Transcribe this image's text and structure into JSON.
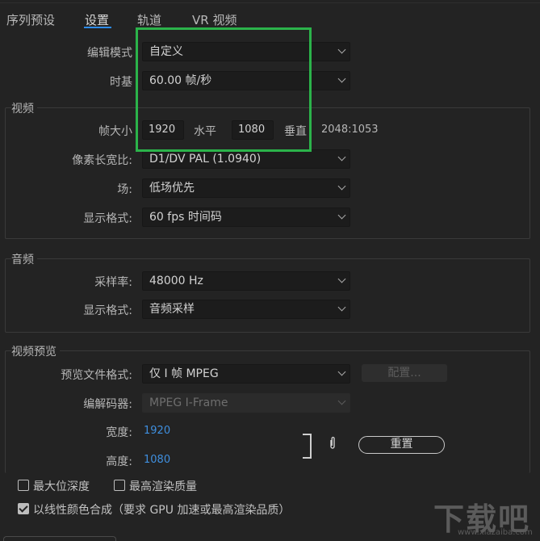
{
  "tabs": [
    {
      "label": "序列预设"
    },
    {
      "label": "设置"
    },
    {
      "label": "轨道"
    },
    {
      "label": "VR 视频"
    }
  ],
  "general": {
    "editing_mode_label": "编辑模式",
    "editing_mode_value": "自定义",
    "timebase_label": "时基",
    "timebase_value": "60.00  帧/秒"
  },
  "video": {
    "section_title": "视频",
    "frame_size_label": "帧大小",
    "frame_width": "1920",
    "horizontal_label": "水平",
    "frame_height": "1080",
    "vertical_label": "垂直",
    "aspect_readout": "2048:1053",
    "pixel_aspect_label": "像素长宽比:",
    "pixel_aspect_value": "D1/DV PAL (1.0940)",
    "fields_label": "场:",
    "fields_value": "低场优先",
    "display_format_label": "显示格式:",
    "display_format_value": "60 fps 时间码"
  },
  "audio": {
    "section_title": "音频",
    "sample_rate_label": "采样率:",
    "sample_rate_value": "48000 Hz",
    "display_format_label": "显示格式:",
    "display_format_value": "音频采样"
  },
  "video_preview": {
    "section_title": "视频预览",
    "preview_format_label": "预览文件格式:",
    "preview_format_value": "仅 I 帧 MPEG",
    "configure_label": "配置...",
    "codec_label": "编解码器:",
    "codec_value": "MPEG I-Frame",
    "width_label": "宽度:",
    "width_value": "1920",
    "height_label": "高度:",
    "height_value": "1080",
    "reset_label": "重置"
  },
  "options": {
    "max_bit_depth_label": "最大位深度",
    "max_bit_depth_checked": false,
    "max_render_quality_label": "最高渲染质量",
    "max_render_quality_checked": false,
    "linear_color_label": "以线性颜色合成（要求 GPU 加速或最高渲染品质）",
    "linear_color_checked": true
  },
  "watermark": {
    "text": "下载吧",
    "url": "www.xiazaiba.com"
  },
  "colors": {
    "background": "#232323",
    "accent_blue": "#2d8ceb",
    "highlight_green": "#2bb34a",
    "value_blue": "#3f8fdf"
  }
}
